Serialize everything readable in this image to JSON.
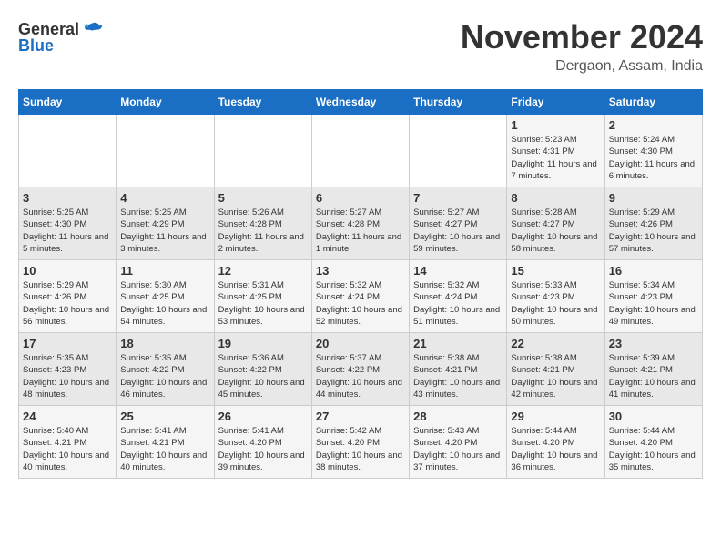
{
  "logo": {
    "general": "General",
    "blue": "Blue"
  },
  "title": "November 2024",
  "location": "Dergaon, Assam, India",
  "weekdays": [
    "Sunday",
    "Monday",
    "Tuesday",
    "Wednesday",
    "Thursday",
    "Friday",
    "Saturday"
  ],
  "weeks": [
    [
      {
        "day": "",
        "info": ""
      },
      {
        "day": "",
        "info": ""
      },
      {
        "day": "",
        "info": ""
      },
      {
        "day": "",
        "info": ""
      },
      {
        "day": "",
        "info": ""
      },
      {
        "day": "1",
        "info": "Sunrise: 5:23 AM\nSunset: 4:31 PM\nDaylight: 11 hours and 7 minutes."
      },
      {
        "day": "2",
        "info": "Sunrise: 5:24 AM\nSunset: 4:30 PM\nDaylight: 11 hours and 6 minutes."
      }
    ],
    [
      {
        "day": "3",
        "info": "Sunrise: 5:25 AM\nSunset: 4:30 PM\nDaylight: 11 hours and 5 minutes."
      },
      {
        "day": "4",
        "info": "Sunrise: 5:25 AM\nSunset: 4:29 PM\nDaylight: 11 hours and 3 minutes."
      },
      {
        "day": "5",
        "info": "Sunrise: 5:26 AM\nSunset: 4:28 PM\nDaylight: 11 hours and 2 minutes."
      },
      {
        "day": "6",
        "info": "Sunrise: 5:27 AM\nSunset: 4:28 PM\nDaylight: 11 hours and 1 minute."
      },
      {
        "day": "7",
        "info": "Sunrise: 5:27 AM\nSunset: 4:27 PM\nDaylight: 10 hours and 59 minutes."
      },
      {
        "day": "8",
        "info": "Sunrise: 5:28 AM\nSunset: 4:27 PM\nDaylight: 10 hours and 58 minutes."
      },
      {
        "day": "9",
        "info": "Sunrise: 5:29 AM\nSunset: 4:26 PM\nDaylight: 10 hours and 57 minutes."
      }
    ],
    [
      {
        "day": "10",
        "info": "Sunrise: 5:29 AM\nSunset: 4:26 PM\nDaylight: 10 hours and 56 minutes."
      },
      {
        "day": "11",
        "info": "Sunrise: 5:30 AM\nSunset: 4:25 PM\nDaylight: 10 hours and 54 minutes."
      },
      {
        "day": "12",
        "info": "Sunrise: 5:31 AM\nSunset: 4:25 PM\nDaylight: 10 hours and 53 minutes."
      },
      {
        "day": "13",
        "info": "Sunrise: 5:32 AM\nSunset: 4:24 PM\nDaylight: 10 hours and 52 minutes."
      },
      {
        "day": "14",
        "info": "Sunrise: 5:32 AM\nSunset: 4:24 PM\nDaylight: 10 hours and 51 minutes."
      },
      {
        "day": "15",
        "info": "Sunrise: 5:33 AM\nSunset: 4:23 PM\nDaylight: 10 hours and 50 minutes."
      },
      {
        "day": "16",
        "info": "Sunrise: 5:34 AM\nSunset: 4:23 PM\nDaylight: 10 hours and 49 minutes."
      }
    ],
    [
      {
        "day": "17",
        "info": "Sunrise: 5:35 AM\nSunset: 4:23 PM\nDaylight: 10 hours and 48 minutes."
      },
      {
        "day": "18",
        "info": "Sunrise: 5:35 AM\nSunset: 4:22 PM\nDaylight: 10 hours and 46 minutes."
      },
      {
        "day": "19",
        "info": "Sunrise: 5:36 AM\nSunset: 4:22 PM\nDaylight: 10 hours and 45 minutes."
      },
      {
        "day": "20",
        "info": "Sunrise: 5:37 AM\nSunset: 4:22 PM\nDaylight: 10 hours and 44 minutes."
      },
      {
        "day": "21",
        "info": "Sunrise: 5:38 AM\nSunset: 4:21 PM\nDaylight: 10 hours and 43 minutes."
      },
      {
        "day": "22",
        "info": "Sunrise: 5:38 AM\nSunset: 4:21 PM\nDaylight: 10 hours and 42 minutes."
      },
      {
        "day": "23",
        "info": "Sunrise: 5:39 AM\nSunset: 4:21 PM\nDaylight: 10 hours and 41 minutes."
      }
    ],
    [
      {
        "day": "24",
        "info": "Sunrise: 5:40 AM\nSunset: 4:21 PM\nDaylight: 10 hours and 40 minutes."
      },
      {
        "day": "25",
        "info": "Sunrise: 5:41 AM\nSunset: 4:21 PM\nDaylight: 10 hours and 40 minutes."
      },
      {
        "day": "26",
        "info": "Sunrise: 5:41 AM\nSunset: 4:20 PM\nDaylight: 10 hours and 39 minutes."
      },
      {
        "day": "27",
        "info": "Sunrise: 5:42 AM\nSunset: 4:20 PM\nDaylight: 10 hours and 38 minutes."
      },
      {
        "day": "28",
        "info": "Sunrise: 5:43 AM\nSunset: 4:20 PM\nDaylight: 10 hours and 37 minutes."
      },
      {
        "day": "29",
        "info": "Sunrise: 5:44 AM\nSunset: 4:20 PM\nDaylight: 10 hours and 36 minutes."
      },
      {
        "day": "30",
        "info": "Sunrise: 5:44 AM\nSunset: 4:20 PM\nDaylight: 10 hours and 35 minutes."
      }
    ]
  ]
}
